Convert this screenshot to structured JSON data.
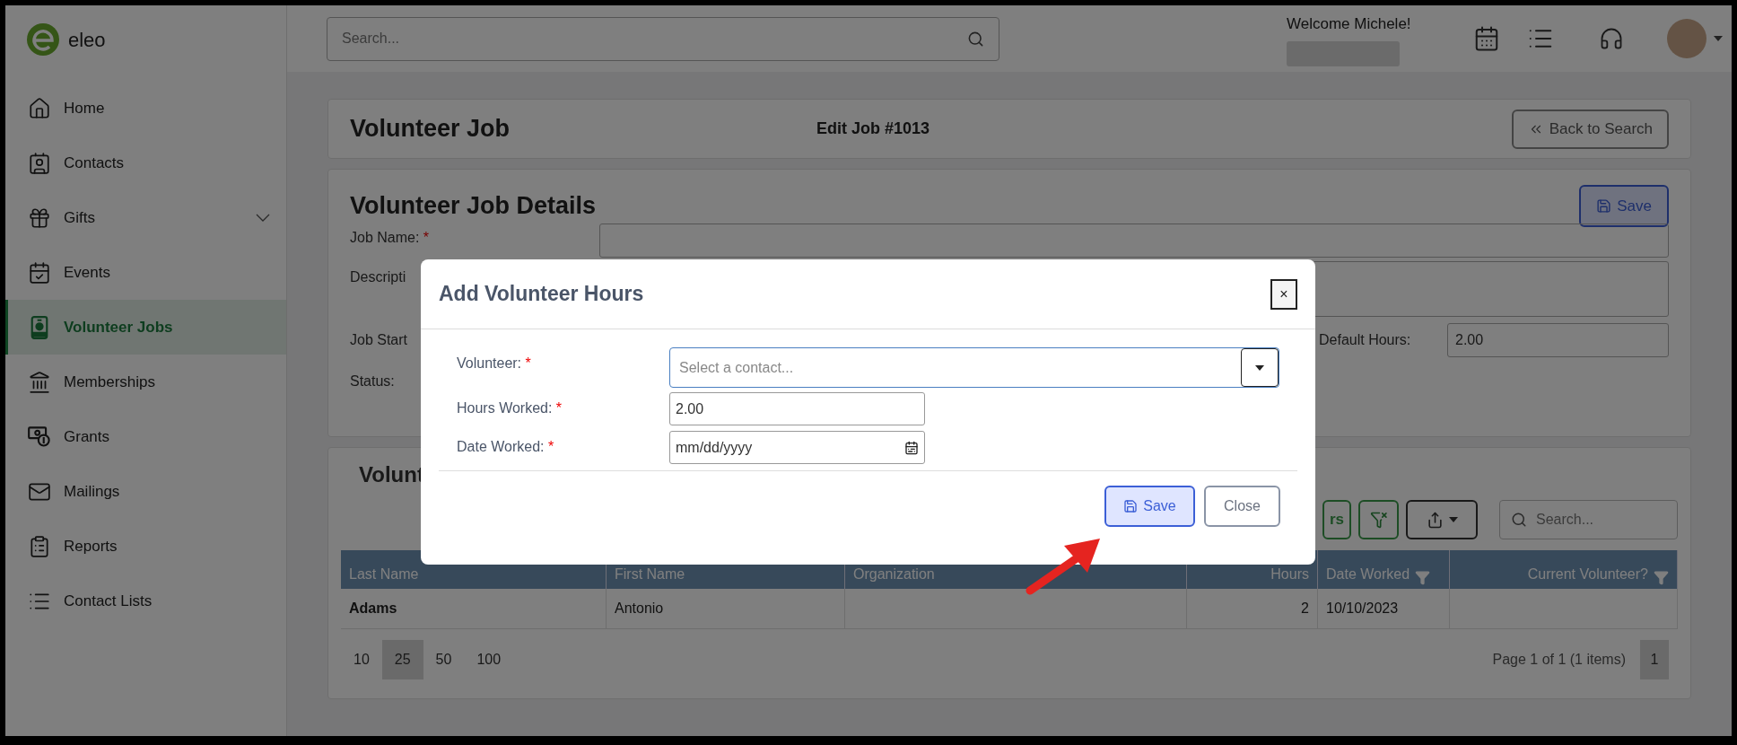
{
  "app": {
    "logo_text": "eleo"
  },
  "topbar": {
    "search": {
      "placeholder": "Search..."
    },
    "welcome": "Welcome Michele!"
  },
  "sidebar": {
    "items": [
      {
        "label": "Home",
        "selected": false,
        "expandable": false
      },
      {
        "label": "Contacts",
        "selected": false,
        "expandable": false
      },
      {
        "label": "Gifts",
        "selected": false,
        "expandable": true
      },
      {
        "label": "Events",
        "selected": false,
        "expandable": false
      },
      {
        "label": "Volunteer Jobs",
        "selected": true,
        "expandable": false
      },
      {
        "label": "Memberships",
        "selected": false,
        "expandable": false
      },
      {
        "label": "Grants",
        "selected": false,
        "expandable": false
      },
      {
        "label": "Mailings",
        "selected": false,
        "expandable": false
      },
      {
        "label": "Reports",
        "selected": false,
        "expandable": false
      },
      {
        "label": "Contact Lists",
        "selected": false,
        "expandable": false
      }
    ]
  },
  "header": {
    "title": "Volunteer Job",
    "subtitle": "Edit Job #1013",
    "back_button": "Back to Search"
  },
  "details": {
    "title": "Volunteer Job Details",
    "save_button": "Save",
    "job_name_label": "Job Name:",
    "required_mark": "*",
    "description_label": "Descripti",
    "job_start_label": "Job Start",
    "default_hours_label": "Default Hours:",
    "default_hours_value": "2.00",
    "status_label": "Status:"
  },
  "volunteers": {
    "title": "Volunt",
    "add_button_tail": "rs",
    "search": {
      "placeholder": "Search..."
    },
    "table": {
      "columns": [
        {
          "label": "Last Name",
          "filter": false
        },
        {
          "label": "First Name",
          "filter": false
        },
        {
          "label": "Organization",
          "filter": false
        },
        {
          "label": "Hours",
          "filter": false
        },
        {
          "label": "Date Worked",
          "filter": true
        },
        {
          "label": "Current Volunteer?",
          "filter": true
        }
      ],
      "rows": [
        {
          "last_name": "Adams",
          "first_name": "Antonio",
          "hours": "2",
          "date_worked": "10/10/2023"
        }
      ]
    },
    "page_sizes": [
      {
        "label": "10",
        "selected": false
      },
      {
        "label": "25",
        "selected": true
      },
      {
        "label": "50",
        "selected": false
      },
      {
        "label": "100",
        "selected": false
      }
    ],
    "page_info": "Page 1 of 1 (1 items)",
    "pages": [
      {
        "label": "1",
        "selected": true
      }
    ]
  },
  "dialog": {
    "title": "Add Volunteer Hours",
    "close": "×",
    "fields": [
      {
        "kind": "select",
        "label": "Volunteer:",
        "required_mark": "*",
        "placeholder": "Select a contact..."
      },
      {
        "kind": "text",
        "label": "Hours Worked:",
        "required_mark": "*",
        "value": "2.00"
      },
      {
        "kind": "date",
        "label": "Date Worked:",
        "required_mark": "*",
        "value": "mm/dd/yyyy"
      }
    ],
    "buttons": [
      {
        "label": "Save",
        "kind": "primary"
      },
      {
        "label": "Close",
        "kind": "secondary"
      }
    ]
  }
}
